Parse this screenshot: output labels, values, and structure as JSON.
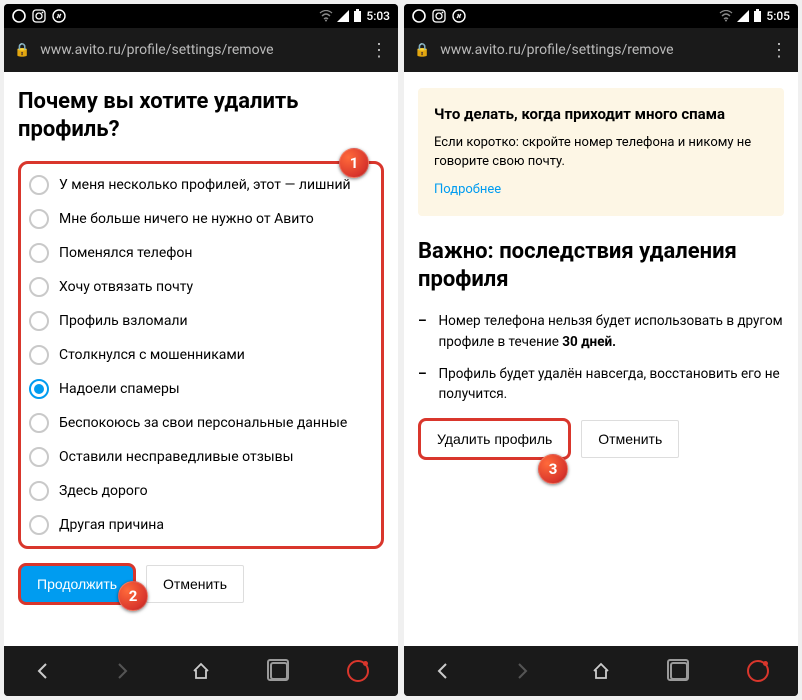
{
  "left": {
    "time": "5:03",
    "url": "www.avito.ru/profile/settings/remove",
    "title": "Почему вы хотите удалить профиль?",
    "options": [
      "У меня несколько профилей, этот — лишний",
      "Мне больше ничего не нужно от Авито",
      "Поменялся телефон",
      "Хочу отвязать почту",
      "Профиль взломали",
      "Столкнулся с мошенниками",
      "Надоели спамеры",
      "Беспокоюсь за свои персональные данные",
      "Оставили несправедливые отзывы",
      "Здесь дорого",
      "Другая причина"
    ],
    "selectedIndex": 6,
    "continue_label": "Продолжить",
    "cancel_label": "Отменить"
  },
  "right": {
    "time": "5:05",
    "url": "www.avito.ru/profile/settings/remove",
    "info_title": "Что делать, когда приходит много спама",
    "info_body": "Если коротко: скройте номер телефона и никому не говорите свою почту.",
    "info_link": "Подробнее",
    "title": "Важно: последствия удаления профиля",
    "bullet1_a": "Номер телефона нельзя будет использовать в другом профиле в течение ",
    "bullet1_b": "30 дней.",
    "bullet2": "Профиль будет удалён навсегда, восстановить его не получится.",
    "delete_label": "Удалить профиль",
    "cancel_label": "Отменить"
  },
  "badges": {
    "one": "1",
    "two": "2",
    "three": "3"
  }
}
